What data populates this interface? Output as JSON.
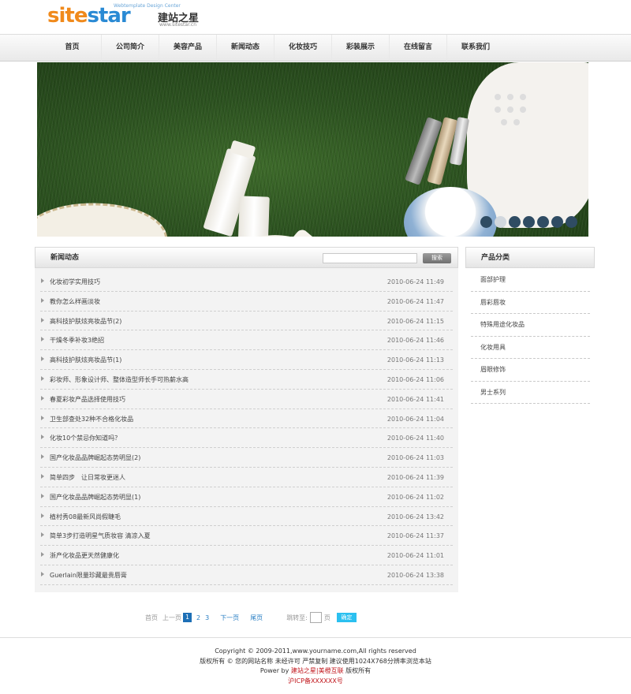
{
  "logo": {
    "wordmark_a": "site",
    "wordmark_b": "star",
    "tagline": "Webtemplate Design Center",
    "cn_name": "建站之星",
    "url": "www.sitestar.cn"
  },
  "nav": {
    "items": [
      "首页",
      "公司简介",
      "美容产品",
      "新闻动态",
      "化妆技巧",
      "彩装展示",
      "在线留言",
      "联系我们"
    ]
  },
  "banner": {
    "slide_count": 7,
    "active_slide": 2
  },
  "news": {
    "title": "新闻动态",
    "search_placeholder": "",
    "search_button": "搜索",
    "items": [
      {
        "title": "化妆初学实用技巧",
        "date": "2010-06-24 11:49"
      },
      {
        "title": "教你怎么样画淡妆",
        "date": "2010-06-24 11:47"
      },
      {
        "title": "高科技护肤炫亮妆品节(2)",
        "date": "2010-06-24 11:15"
      },
      {
        "title": "干燥冬季补妆3绝招",
        "date": "2010-06-24 11:46"
      },
      {
        "title": "高科技护肤炫亮妆品节(1)",
        "date": "2010-06-24 11:13"
      },
      {
        "title": "彩妆师、形象设计师、整体造型师长手可热薪水高",
        "date": "2010-06-24 11:06"
      },
      {
        "title": "春夏彩妆产品选择使用技巧",
        "date": "2010-06-24 11:41"
      },
      {
        "title": "卫生部查处32种不合格化妆品",
        "date": "2010-06-24 11:04"
      },
      {
        "title": "化妆10个禁忌你知道吗？",
        "date": "2010-06-24 11:40"
      },
      {
        "title": "国产化妆品品牌崛起态势明显(2)",
        "date": "2010-06-24 11:03"
      },
      {
        "title": "简单四步　让日常妆更迷人",
        "date": "2010-06-24 11:39"
      },
      {
        "title": "国产化妆品品牌崛起态势明显(1)",
        "date": "2010-06-24 11:02"
      },
      {
        "title": "植村秀08最新风尚假睫毛",
        "date": "2010-06-24 13:42"
      },
      {
        "title": "简单3步打造明星气质妆容 清凉入夏",
        "date": "2010-06-24 11:37"
      },
      {
        "title": "浙产化妆品更天然健康化",
        "date": "2010-06-24 11:01"
      },
      {
        "title": "Guerlain限量珍藏最贵唇膏",
        "date": "2010-06-24 13:38"
      }
    ]
  },
  "categories": {
    "title": "产品分类",
    "items": [
      "面部护理",
      "唇彩唇妆",
      "特殊用途化妆品",
      "化妆用具",
      "眉眼修饰",
      "男士系列"
    ]
  },
  "pager": {
    "first": "首页",
    "prev": "上一页",
    "pages": [
      "1",
      "2",
      "3"
    ],
    "current": "1",
    "next": "下一页",
    "last": "尾页",
    "jump_label": "跳转至:",
    "page_unit": "页",
    "go": "确定"
  },
  "footer": {
    "copyright": "Copyright © 2009-2011,www.yourname.com,All rights reserved",
    "rights_line": "版权所有 © 您的网站名称  未经许可  严禁复制  建议使用1024X768分辨率浏览本站",
    "power_prefix": "Power by ",
    "power_link": "建站之星|美橙互联",
    "power_suffix": " 版权所有",
    "icp": "沪ICP备XXXXXX号"
  },
  "colors": {
    "logo_orange": "#f08a1c",
    "logo_blue": "#2a8ad4",
    "pager_current": "#1d6fb6",
    "go_button": "#2bc0f0",
    "footer_link": "#c0141a"
  }
}
